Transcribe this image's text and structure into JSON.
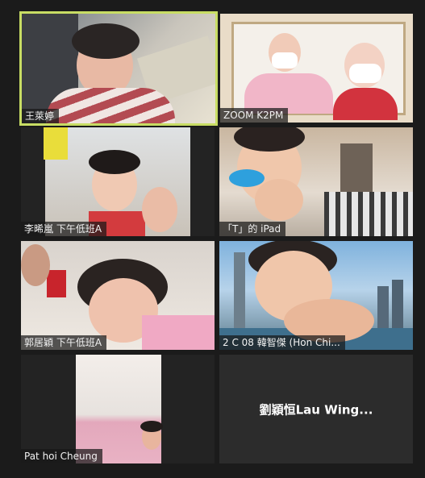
{
  "participants": [
    {
      "name": "王萊婷",
      "active": true,
      "video": true
    },
    {
      "name": "ZOOM K2PM",
      "active": false,
      "video": true
    },
    {
      "name": "李晞嵐 下午低班A",
      "active": false,
      "video": true
    },
    {
      "name": "「T」的 iPad",
      "active": false,
      "video": true
    },
    {
      "name": "郭居穎 下午低班A",
      "active": false,
      "video": true
    },
    {
      "name": "2 C 08  韓智傑  (Hon Chi...",
      "active": false,
      "video": true
    },
    {
      "name": "Pat hoi Cheung",
      "active": false,
      "video": true
    },
    {
      "name": "劉穎恒Lau  Wing...",
      "active": false,
      "video": false
    }
  ],
  "colors": {
    "background": "#1b1b1b",
    "active_speaker_border": "#c8dd64",
    "label_bg": "#181818",
    "label_text": "#f2f2f2"
  }
}
